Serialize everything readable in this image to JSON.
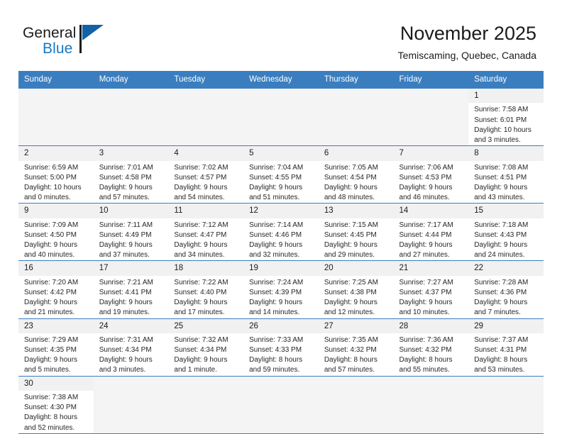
{
  "brand": {
    "name_part1": "General",
    "name_part2": "Blue",
    "accent_color": "#1878c8",
    "flag_color": "#1262a8"
  },
  "header": {
    "title": "November 2025",
    "subtitle": "Temiscaming, Quebec, Canada"
  },
  "calendar": {
    "header_bg": "#3a7ebf",
    "weekdays": [
      "Sunday",
      "Monday",
      "Tuesday",
      "Wednesday",
      "Thursday",
      "Friday",
      "Saturday"
    ],
    "labels": {
      "sunrise": "Sunrise:",
      "sunset": "Sunset:",
      "daylight": "Daylight:"
    },
    "weeks": [
      [
        {
          "day": ""
        },
        {
          "day": ""
        },
        {
          "day": ""
        },
        {
          "day": ""
        },
        {
          "day": ""
        },
        {
          "day": ""
        },
        {
          "day": "1",
          "sunrise": "Sunrise: 7:58 AM",
          "sunset": "Sunset: 6:01 PM",
          "daylight1": "Daylight: 10 hours",
          "daylight2": "and 3 minutes."
        }
      ],
      [
        {
          "day": "2",
          "sunrise": "Sunrise: 6:59 AM",
          "sunset": "Sunset: 5:00 PM",
          "daylight1": "Daylight: 10 hours",
          "daylight2": "and 0 minutes."
        },
        {
          "day": "3",
          "sunrise": "Sunrise: 7:01 AM",
          "sunset": "Sunset: 4:58 PM",
          "daylight1": "Daylight: 9 hours",
          "daylight2": "and 57 minutes."
        },
        {
          "day": "4",
          "sunrise": "Sunrise: 7:02 AM",
          "sunset": "Sunset: 4:57 PM",
          "daylight1": "Daylight: 9 hours",
          "daylight2": "and 54 minutes."
        },
        {
          "day": "5",
          "sunrise": "Sunrise: 7:04 AM",
          "sunset": "Sunset: 4:55 PM",
          "daylight1": "Daylight: 9 hours",
          "daylight2": "and 51 minutes."
        },
        {
          "day": "6",
          "sunrise": "Sunrise: 7:05 AM",
          "sunset": "Sunset: 4:54 PM",
          "daylight1": "Daylight: 9 hours",
          "daylight2": "and 48 minutes."
        },
        {
          "day": "7",
          "sunrise": "Sunrise: 7:06 AM",
          "sunset": "Sunset: 4:53 PM",
          "daylight1": "Daylight: 9 hours",
          "daylight2": "and 46 minutes."
        },
        {
          "day": "8",
          "sunrise": "Sunrise: 7:08 AM",
          "sunset": "Sunset: 4:51 PM",
          "daylight1": "Daylight: 9 hours",
          "daylight2": "and 43 minutes."
        }
      ],
      [
        {
          "day": "9",
          "sunrise": "Sunrise: 7:09 AM",
          "sunset": "Sunset: 4:50 PM",
          "daylight1": "Daylight: 9 hours",
          "daylight2": "and 40 minutes."
        },
        {
          "day": "10",
          "sunrise": "Sunrise: 7:11 AM",
          "sunset": "Sunset: 4:49 PM",
          "daylight1": "Daylight: 9 hours",
          "daylight2": "and 37 minutes."
        },
        {
          "day": "11",
          "sunrise": "Sunrise: 7:12 AM",
          "sunset": "Sunset: 4:47 PM",
          "daylight1": "Daylight: 9 hours",
          "daylight2": "and 34 minutes."
        },
        {
          "day": "12",
          "sunrise": "Sunrise: 7:14 AM",
          "sunset": "Sunset: 4:46 PM",
          "daylight1": "Daylight: 9 hours",
          "daylight2": "and 32 minutes."
        },
        {
          "day": "13",
          "sunrise": "Sunrise: 7:15 AM",
          "sunset": "Sunset: 4:45 PM",
          "daylight1": "Daylight: 9 hours",
          "daylight2": "and 29 minutes."
        },
        {
          "day": "14",
          "sunrise": "Sunrise: 7:17 AM",
          "sunset": "Sunset: 4:44 PM",
          "daylight1": "Daylight: 9 hours",
          "daylight2": "and 27 minutes."
        },
        {
          "day": "15",
          "sunrise": "Sunrise: 7:18 AM",
          "sunset": "Sunset: 4:43 PM",
          "daylight1": "Daylight: 9 hours",
          "daylight2": "and 24 minutes."
        }
      ],
      [
        {
          "day": "16",
          "sunrise": "Sunrise: 7:20 AM",
          "sunset": "Sunset: 4:42 PM",
          "daylight1": "Daylight: 9 hours",
          "daylight2": "and 21 minutes."
        },
        {
          "day": "17",
          "sunrise": "Sunrise: 7:21 AM",
          "sunset": "Sunset: 4:41 PM",
          "daylight1": "Daylight: 9 hours",
          "daylight2": "and 19 minutes."
        },
        {
          "day": "18",
          "sunrise": "Sunrise: 7:22 AM",
          "sunset": "Sunset: 4:40 PM",
          "daylight1": "Daylight: 9 hours",
          "daylight2": "and 17 minutes."
        },
        {
          "day": "19",
          "sunrise": "Sunrise: 7:24 AM",
          "sunset": "Sunset: 4:39 PM",
          "daylight1": "Daylight: 9 hours",
          "daylight2": "and 14 minutes."
        },
        {
          "day": "20",
          "sunrise": "Sunrise: 7:25 AM",
          "sunset": "Sunset: 4:38 PM",
          "daylight1": "Daylight: 9 hours",
          "daylight2": "and 12 minutes."
        },
        {
          "day": "21",
          "sunrise": "Sunrise: 7:27 AM",
          "sunset": "Sunset: 4:37 PM",
          "daylight1": "Daylight: 9 hours",
          "daylight2": "and 10 minutes."
        },
        {
          "day": "22",
          "sunrise": "Sunrise: 7:28 AM",
          "sunset": "Sunset: 4:36 PM",
          "daylight1": "Daylight: 9 hours",
          "daylight2": "and 7 minutes."
        }
      ],
      [
        {
          "day": "23",
          "sunrise": "Sunrise: 7:29 AM",
          "sunset": "Sunset: 4:35 PM",
          "daylight1": "Daylight: 9 hours",
          "daylight2": "and 5 minutes."
        },
        {
          "day": "24",
          "sunrise": "Sunrise: 7:31 AM",
          "sunset": "Sunset: 4:34 PM",
          "daylight1": "Daylight: 9 hours",
          "daylight2": "and 3 minutes."
        },
        {
          "day": "25",
          "sunrise": "Sunrise: 7:32 AM",
          "sunset": "Sunset: 4:34 PM",
          "daylight1": "Daylight: 9 hours",
          "daylight2": "and 1 minute."
        },
        {
          "day": "26",
          "sunrise": "Sunrise: 7:33 AM",
          "sunset": "Sunset: 4:33 PM",
          "daylight1": "Daylight: 8 hours",
          "daylight2": "and 59 minutes."
        },
        {
          "day": "27",
          "sunrise": "Sunrise: 7:35 AM",
          "sunset": "Sunset: 4:32 PM",
          "daylight1": "Daylight: 8 hours",
          "daylight2": "and 57 minutes."
        },
        {
          "day": "28",
          "sunrise": "Sunrise: 7:36 AM",
          "sunset": "Sunset: 4:32 PM",
          "daylight1": "Daylight: 8 hours",
          "daylight2": "and 55 minutes."
        },
        {
          "day": "29",
          "sunrise": "Sunrise: 7:37 AM",
          "sunset": "Sunset: 4:31 PM",
          "daylight1": "Daylight: 8 hours",
          "daylight2": "and 53 minutes."
        }
      ],
      [
        {
          "day": "30",
          "sunrise": "Sunrise: 7:38 AM",
          "sunset": "Sunset: 4:30 PM",
          "daylight1": "Daylight: 8 hours",
          "daylight2": "and 52 minutes."
        },
        {
          "day": ""
        },
        {
          "day": ""
        },
        {
          "day": ""
        },
        {
          "day": ""
        },
        {
          "day": ""
        },
        {
          "day": ""
        }
      ]
    ]
  }
}
